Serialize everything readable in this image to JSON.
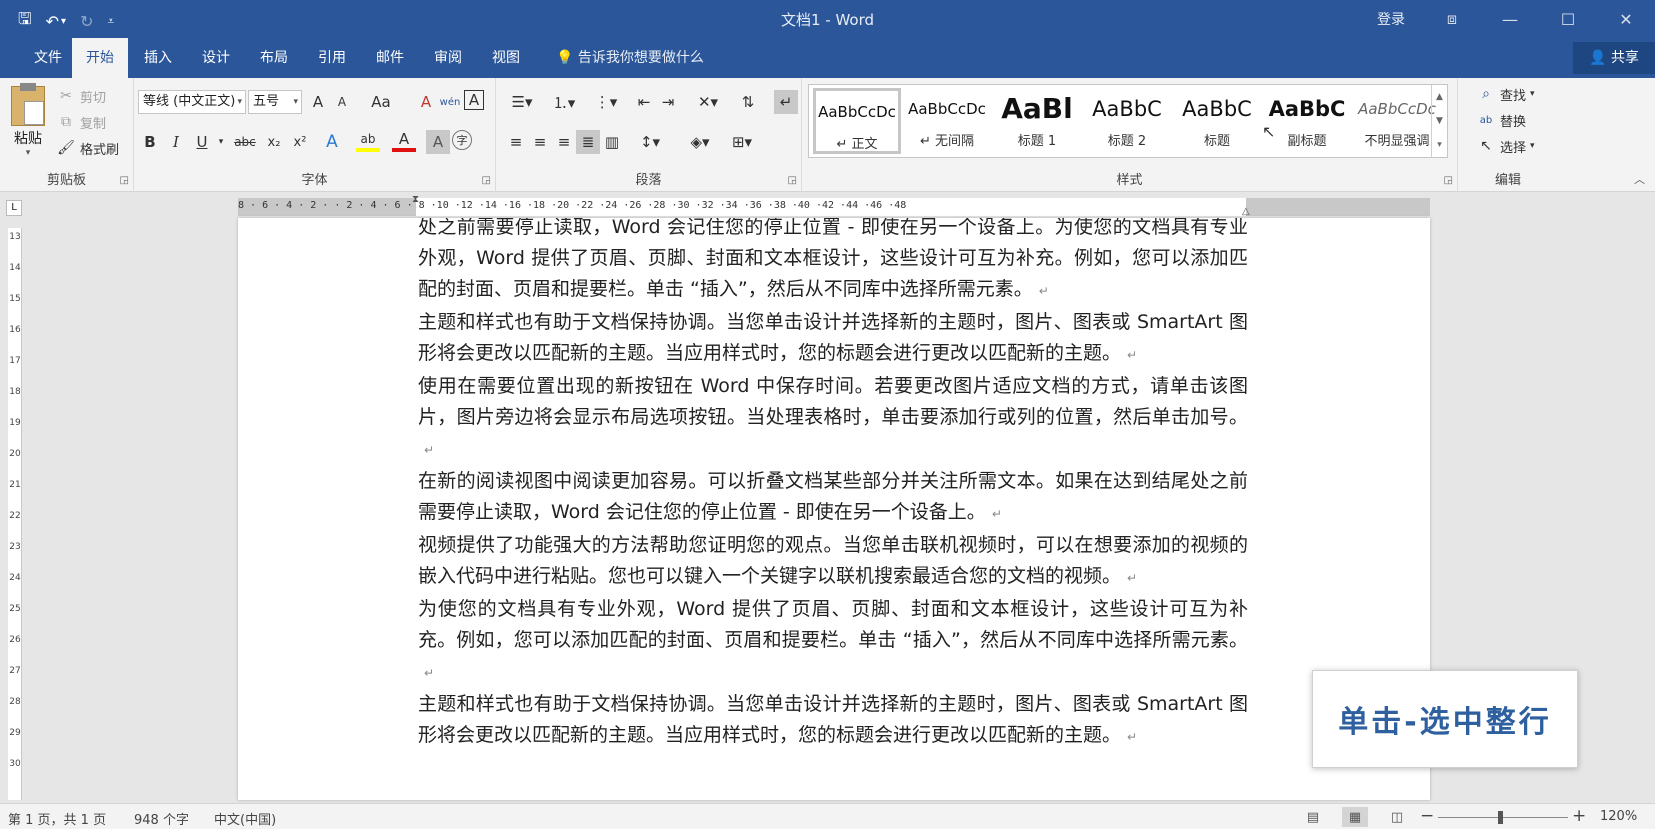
{
  "window": {
    "title": "文档1  -  Word",
    "login": "登录",
    "controls": {
      "ribbon_display": "⧈",
      "minimize": "—",
      "maximize": "☐",
      "close": "✕"
    }
  },
  "qat": {
    "save": "🖫",
    "undo": "↶",
    "undo_more": "▾",
    "redo": "↻",
    "customize": "⩡"
  },
  "tabs": [
    "文件",
    "开始",
    "插入",
    "设计",
    "布局",
    "引用",
    "邮件",
    "审阅",
    "视图"
  ],
  "active_tab": "开始",
  "tellme": "告诉我你想要做什么",
  "share": "共享",
  "clipboard": {
    "paste": "粘贴",
    "cut": "剪切",
    "copy": "复制",
    "format_painter": "格式刷",
    "label": "剪贴板"
  },
  "font": {
    "name": "等线 (中文正文)",
    "size": "五号",
    "label": "字体",
    "buttons": {
      "grow": "A",
      "shrink": "A",
      "case": "Aa",
      "clear": "A",
      "phonetic": "wén",
      "border": "A",
      "bold": "B",
      "italic": "I",
      "underline": "U",
      "strike": "abc",
      "sub": "x₂",
      "sup": "x²",
      "effects": "A",
      "highlight": "ab",
      "color": "A",
      "shade": "A",
      "enclose": "字"
    }
  },
  "paragraph": {
    "label": "段落"
  },
  "styles": {
    "label": "样式",
    "items": [
      {
        "preview": "AaBbCcDc",
        "name": "↵ 正文"
      },
      {
        "preview": "AaBbCcDc",
        "name": "↵ 无间隔"
      },
      {
        "preview": "AaBl",
        "name": "标题 1"
      },
      {
        "preview": "AaBbC",
        "name": "标题 2"
      },
      {
        "preview": "AaBbC",
        "name": "标题"
      },
      {
        "preview": "AaBbC",
        "name": "副标题"
      },
      {
        "preview": "AaBbCcDc",
        "name": "不明显强调"
      }
    ]
  },
  "editing": {
    "find": "查找",
    "replace": "替换",
    "select": "选择",
    "label": "编辑"
  },
  "ruler": {
    "h_labels": "8 · 6 · 4 · 2 ·     · 2 · 4 · 6 · 8 ·10 ·12 ·14 ·16 ·18 ·20 ·22 ·24 ·26 ·28 ·30 ·32 ·34 ·36 ·38 ·40 ·42 ·44 ·46 ·48",
    "v_labels": [
      "13",
      "14",
      "15",
      "16",
      "17",
      "18",
      "19",
      "20",
      "21",
      "22",
      "23",
      "24",
      "25",
      "26",
      "27",
      "28",
      "29",
      "30"
    ]
  },
  "document": {
    "paragraphs": [
      "处之前需要停止读取，Word 会记住您的停止位置 - 即使在另一个设备上。为使您的文档具有专业外观，Word 提供了页眉、页脚、封面和文本框设计，这些设计可互为补充。例如，您可以添加匹配的封面、页眉和提要栏。单击 “插入”，然后从不同库中选择所需元素。",
      "主题和样式也有助于文档保持协调。当您单击设计并选择新的主题时，图片、图表或 SmartArt 图形将会更改以匹配新的主题。当应用样式时，您的标题会进行更改以匹配新的主题。",
      "使用在需要位置出现的新按钮在 Word 中保存时间。若要更改图片适应文档的方式，请单击该图片，图片旁边将会显示布局选项按钮。当处理表格时，单击要添加行或列的位置，然后单击加号。",
      "在新的阅读视图中阅读更加容易。可以折叠文档某些部分并关注所需文本。如果在达到结尾处之前需要停止读取，Word 会记住您的停止位置 - 即使在另一个设备上。",
      "视频提供了功能强大的方法帮助您证明您的观点。当您单击联机视频时，可以在想要添加的视频的嵌入代码中进行粘贴。您也可以键入一个关键字以联机搜索最适合您的文档的视频。",
      "为使您的文档具有专业外观，Word 提供了页眉、页脚、封面和文本框设计，这些设计可互为补充。例如，您可以添加匹配的封面、页眉和提要栏。单击 “插入”，然后从不同库中选择所需元素。",
      "主题和样式也有助于文档保持协调。当您单击设计并选择新的主题时，图片、图表或 SmartArt 图形将会更改以匹配新的主题。当应用样式时，您的标题会进行更改以匹配新的主题。"
    ],
    "para_mark": "↵"
  },
  "callout": "单击-选中整行",
  "status": {
    "page": "第 1 页，共 1 页",
    "words": "948 个字",
    "language": "中文(中国)",
    "zoom_minus": "−",
    "zoom_plus": "+",
    "zoom": "120%"
  }
}
